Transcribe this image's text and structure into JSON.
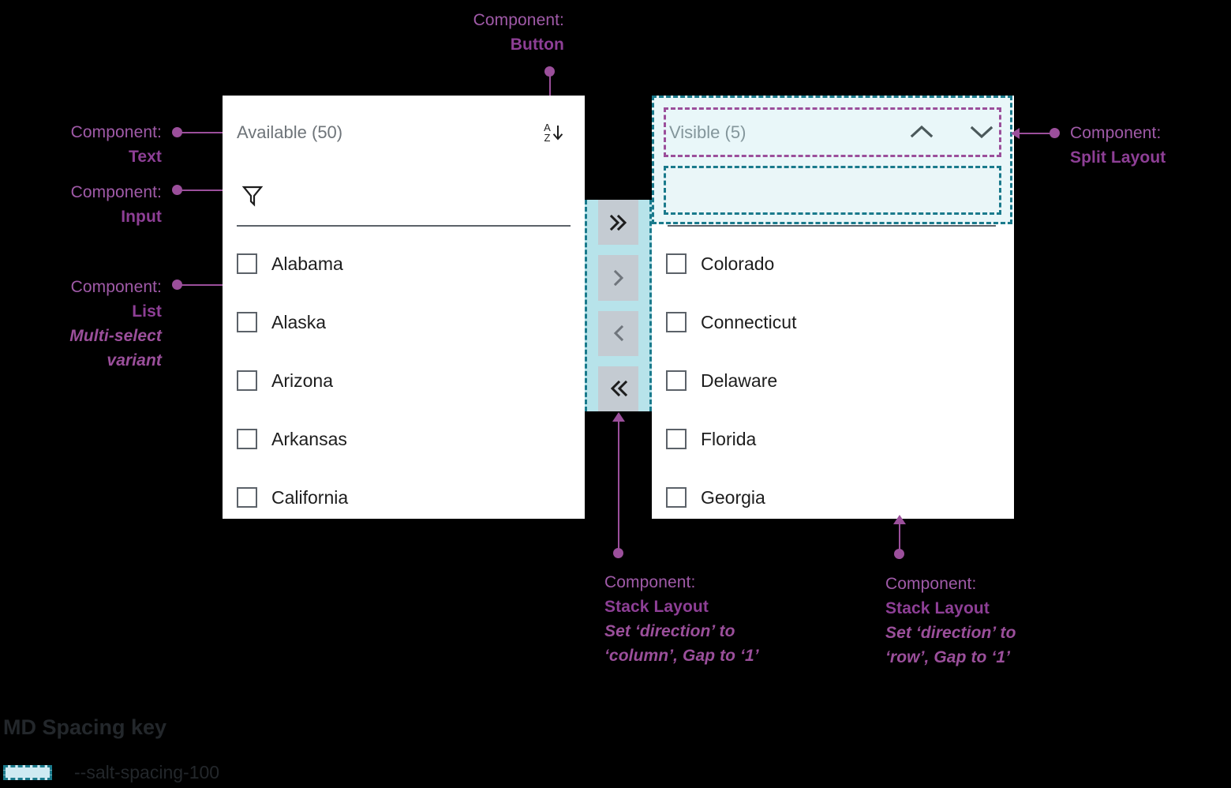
{
  "annotations": {
    "button": {
      "lead": "Component:",
      "strong": "Button"
    },
    "text": {
      "lead": "Component:",
      "strong": "Text"
    },
    "input": {
      "lead": "Component:",
      "strong": "Input"
    },
    "list": {
      "lead": "Component:",
      "strong": "List",
      "note": "Multi-select",
      "note2": "variant"
    },
    "split_layout": {
      "lead": "Component:",
      "strong": "Split Layout"
    },
    "stack_column": {
      "lead": "Component:",
      "strong": "Stack Layout",
      "note": "Set ‘direction’ to",
      "note2": "‘column’, Gap to ‘1’"
    },
    "stack_row": {
      "lead": "Component:",
      "strong": "Stack Layout",
      "note": "Set ‘direction’ to",
      "note2": "‘row’, Gap to ‘1’"
    }
  },
  "left_panel": {
    "title": "Available (50)",
    "sort_icon": "sort-az-descending-icon",
    "sort_letters": {
      "top": "A",
      "bottom": "Z"
    },
    "filter": {
      "icon": "filter-funnel-icon",
      "value": "",
      "placeholder": ""
    },
    "items": [
      {
        "label": "Alabama",
        "checked": false
      },
      {
        "label": "Alaska",
        "checked": false
      },
      {
        "label": "Arizona",
        "checked": false
      },
      {
        "label": "Arkansas",
        "checked": false
      },
      {
        "label": "California",
        "checked": false
      }
    ]
  },
  "right_panel": {
    "title": "Visible (5)",
    "move_up_icon": "chevron-up-icon",
    "move_down_icon": "chevron-down-icon",
    "filter": {
      "icon": "filter-funnel-icon",
      "value": "",
      "placeholder": ""
    },
    "items": [
      {
        "label": "Colorado",
        "checked": false
      },
      {
        "label": "Connecticut",
        "checked": false
      },
      {
        "label": "Delaware",
        "checked": false
      },
      {
        "label": "Florida",
        "checked": false
      },
      {
        "label": "Georgia",
        "checked": false
      }
    ]
  },
  "transfer_buttons": [
    {
      "glyph": "»",
      "name": "move-all-right-button"
    },
    {
      "glyph": "›",
      "name": "move-right-button"
    },
    {
      "glyph": "‹",
      "name": "move-left-button"
    },
    {
      "glyph": "«",
      "name": "move-all-left-button"
    }
  ],
  "spacing_key": {
    "title": "MD Spacing key",
    "token": "--salt-spacing-100",
    "swatch_color": "#cfeaf2",
    "swatch_border": "#1a7a8c"
  },
  "colors": {
    "annotation": "#9b4f9b",
    "spacing_teal": "#1a7a8c",
    "spacing_fill": "#b7e3ea",
    "panel_bg": "#ffffff",
    "button_bg": "#c4cbd2",
    "title_text": "#6e7479",
    "body_text": "#1d1d1d"
  }
}
